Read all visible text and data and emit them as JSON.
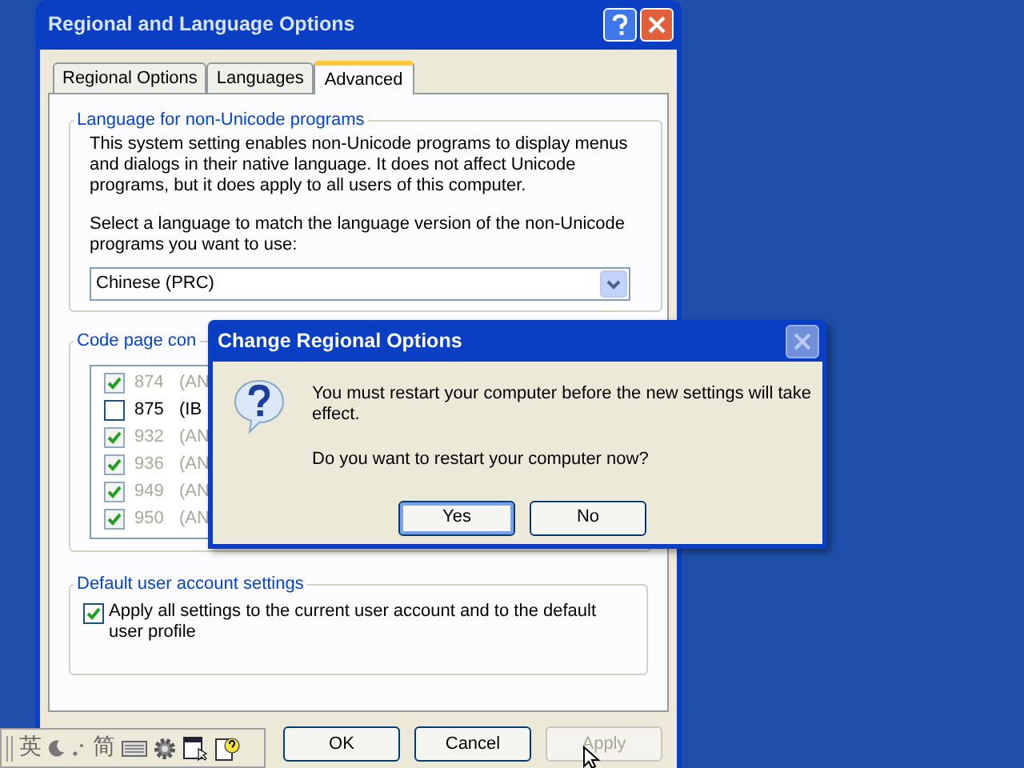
{
  "window": {
    "title": "Regional and Language Options"
  },
  "tabs": [
    {
      "label": "Regional Options",
      "selected": false
    },
    {
      "label": "Languages",
      "selected": false
    },
    {
      "label": "Advanced",
      "selected": true
    }
  ],
  "language_group": {
    "title": "Language for non-Unicode programs",
    "description": "This system setting enables non-Unicode programs to display menus and dialogs in their native language. It does not affect Unicode programs, but it does apply to all users of this computer.",
    "prompt": "Select a language to match the language version of the non-Unicode programs you want to use:",
    "dropdown": {
      "value": "Chinese (PRC)"
    }
  },
  "code_page_group": {
    "title": "Code page con",
    "items": [
      {
        "code": "874",
        "description": "(AN",
        "checked": true,
        "disabled": true
      },
      {
        "code": "875",
        "description": "(IB",
        "checked": false,
        "disabled": false
      },
      {
        "code": "932",
        "description": "(AN",
        "checked": true,
        "disabled": true
      },
      {
        "code": "936",
        "description": "(AN",
        "checked": true,
        "disabled": true
      },
      {
        "code": "949",
        "description": "(AN",
        "checked": true,
        "disabled": true
      },
      {
        "code": "950",
        "description": "(AN",
        "checked": true,
        "disabled": true
      }
    ]
  },
  "default_user_group": {
    "title": "Default user account settings",
    "checkbox": {
      "label": "Apply all settings to the current user account and to the default user profile",
      "checked": true
    }
  },
  "buttons": [
    {
      "label": "OK",
      "disabled": false
    },
    {
      "label": "Cancel",
      "disabled": false
    },
    {
      "label": "Apply",
      "disabled": true
    }
  ],
  "dialog": {
    "title": "Change Regional Options",
    "message": "You must restart your computer before the new settings will take effect.",
    "question": "Do you want to restart your computer now?",
    "buttons": [
      {
        "label": "Yes",
        "selected": true
      },
      {
        "label": "No",
        "selected": false
      }
    ]
  },
  "language_bar": {
    "input_mode": "英",
    "script": "简"
  }
}
